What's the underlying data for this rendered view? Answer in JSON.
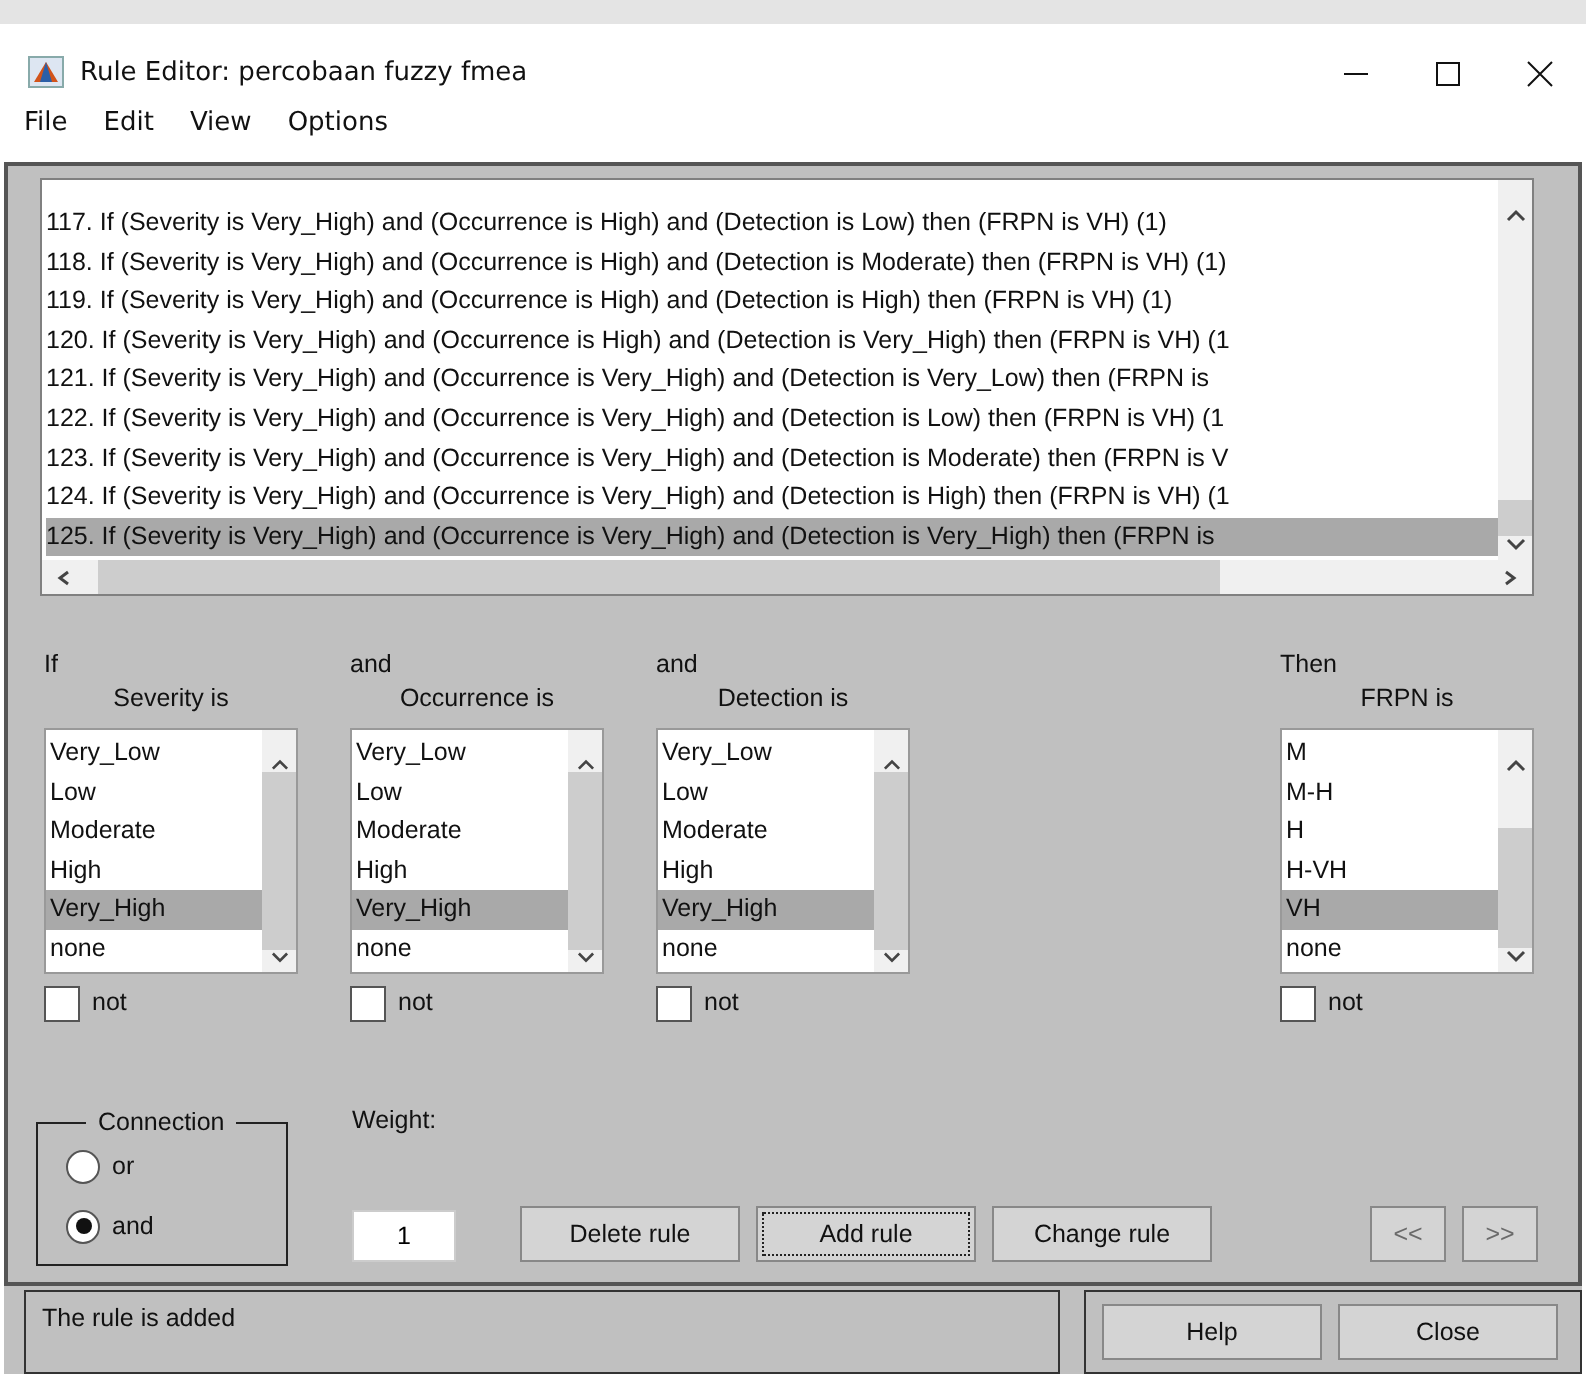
{
  "window": {
    "title": "Rule Editor: percobaan fuzzy fmea"
  },
  "menu": [
    "File",
    "Edit",
    "View",
    "Options"
  ],
  "rules": [
    {
      "text": "117. If (Severity is Very_High) and (Occurrence is High) and (Detection is Low) then (FRPN is VH) (1)",
      "selected": false
    },
    {
      "text": "118. If (Severity is Very_High) and (Occurrence is High) and (Detection is Moderate) then (FRPN is VH) (1)",
      "selected": false
    },
    {
      "text": "119. If (Severity is Very_High) and (Occurrence is High) and (Detection is High) then (FRPN is VH) (1)",
      "selected": false
    },
    {
      "text": "120. If (Severity is Very_High) and (Occurrence is High) and (Detection is Very_High) then (FRPN is VH) (1",
      "selected": false
    },
    {
      "text": "121. If (Severity is Very_High) and (Occurrence is Very_High) and (Detection is Very_Low) then (FRPN is",
      "selected": false
    },
    {
      "text": "122. If (Severity is Very_High) and (Occurrence is Very_High) and (Detection is Low) then (FRPN is VH) (1",
      "selected": false
    },
    {
      "text": "123. If (Severity is Very_High) and (Occurrence is Very_High) and (Detection is Moderate) then (FRPN is V",
      "selected": false
    },
    {
      "text": "124. If (Severity is Very_High) and (Occurrence is Very_High) and (Detection is High) then (FRPN is VH) (1",
      "selected": false
    },
    {
      "text": "125. If (Severity is Very_High) and (Occurrence is Very_High) and (Detection is Very_High) then (FRPN is",
      "selected": true
    }
  ],
  "variables": [
    {
      "kind": "input",
      "connector": "If",
      "label": "Severity is",
      "not_label": "not",
      "not_checked": false,
      "options": [
        {
          "label": "Very_Low",
          "selected": false
        },
        {
          "label": "Low",
          "selected": false
        },
        {
          "label": "Moderate",
          "selected": false
        },
        {
          "label": "High",
          "selected": false
        },
        {
          "label": "Very_High",
          "selected": true
        },
        {
          "label": "none",
          "selected": false
        }
      ]
    },
    {
      "kind": "input",
      "connector": "and",
      "label": "Occurrence is",
      "not_label": "not",
      "not_checked": false,
      "options": [
        {
          "label": "Very_Low",
          "selected": false
        },
        {
          "label": "Low",
          "selected": false
        },
        {
          "label": "Moderate",
          "selected": false
        },
        {
          "label": "High",
          "selected": false
        },
        {
          "label": "Very_High",
          "selected": true
        },
        {
          "label": "none",
          "selected": false
        }
      ]
    },
    {
      "kind": "input",
      "connector": "and",
      "label": "Detection is",
      "not_label": "not",
      "not_checked": false,
      "options": [
        {
          "label": "Very_Low",
          "selected": false
        },
        {
          "label": "Low",
          "selected": false
        },
        {
          "label": "Moderate",
          "selected": false
        },
        {
          "label": "High",
          "selected": false
        },
        {
          "label": "Very_High",
          "selected": true
        },
        {
          "label": "none",
          "selected": false
        }
      ]
    },
    {
      "kind": "output",
      "connector": "Then",
      "label": "FRPN is",
      "not_label": "not",
      "not_checked": false,
      "options": [
        {
          "label": "M",
          "selected": false
        },
        {
          "label": "M-H",
          "selected": false
        },
        {
          "label": "H",
          "selected": false
        },
        {
          "label": "H-VH",
          "selected": false
        },
        {
          "label": "VH",
          "selected": true
        },
        {
          "label": "none",
          "selected": false
        }
      ]
    }
  ],
  "connection": {
    "title": "Connection",
    "options": [
      {
        "label": "or",
        "selected": false
      },
      {
        "label": "and",
        "selected": true
      }
    ]
  },
  "weight": {
    "label": "Weight:",
    "value": "1"
  },
  "rule_buttons": [
    {
      "label": "Delete rule",
      "focused": false
    },
    {
      "label": "Add rule",
      "focused": true
    },
    {
      "label": "Change rule",
      "focused": false
    }
  ],
  "nav_buttons": [
    {
      "label": "<<",
      "disabled": true
    },
    {
      "label": ">>",
      "disabled": true
    }
  ],
  "status": "The rule is added",
  "footer_buttons": [
    "Help",
    "Close"
  ]
}
